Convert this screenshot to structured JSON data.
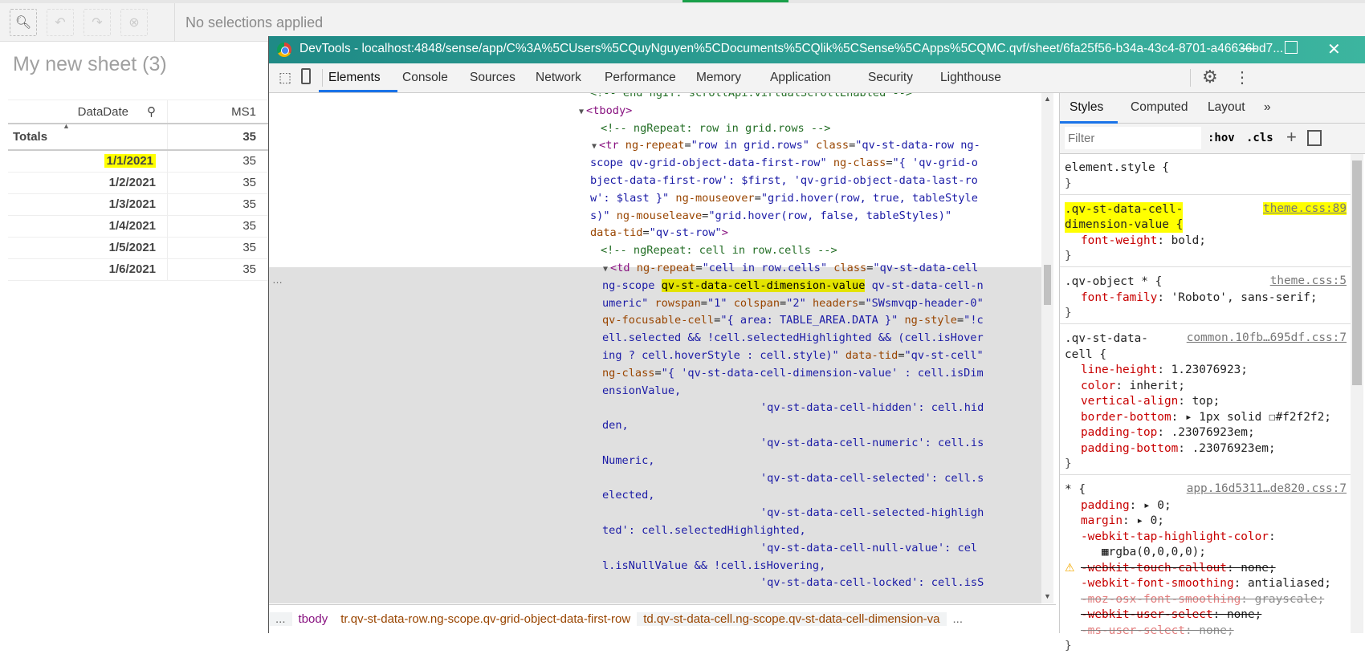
{
  "qlik": {
    "selections_text": "No selections applied",
    "sheet_title": "My new sheet (3)",
    "table": {
      "headers": [
        "DataDate",
        "MS1"
      ],
      "totals_label": "Totals",
      "totals_value": "35",
      "rows": [
        {
          "date": "1/1/2021",
          "value": "35",
          "highlighted": true
        },
        {
          "date": "1/2/2021",
          "value": "35"
        },
        {
          "date": "1/3/2021",
          "value": "35"
        },
        {
          "date": "1/4/2021",
          "value": "35"
        },
        {
          "date": "1/5/2021",
          "value": "35"
        },
        {
          "date": "1/6/2021",
          "value": "35"
        }
      ]
    }
  },
  "devtools": {
    "title": "DevTools - localhost:4848/sense/app/C%3A%5CUsers%5CQuyNguyen%5CDocuments%5CQlik%5CSense%5CApps%5CQMC.qvf/sheet/6fa25f56-b34a-43c4-8701-a46636bd7...",
    "tabs": [
      "Elements",
      "Console",
      "Sources",
      "Network",
      "Performance",
      "Memory",
      "Application",
      "Security",
      "Lighthouse"
    ],
    "active_tab": "Elements",
    "code_lines": [
      [
        [
          "cm",
          "<!-- end ngIf: scrollApi.virtualScrollEnabled -->"
        ]
      ],
      [
        [
          "tri",
          "▼"
        ],
        [
          "tg",
          "<tbody>"
        ]
      ],
      [
        [
          "cm",
          "<!-- ngRepeat: row in grid.rows -->"
        ]
      ],
      [
        [
          "tri",
          "▼"
        ],
        [
          "tg",
          "<tr"
        ],
        [
          "at",
          " ng-repeat"
        ],
        [
          "tx",
          "="
        ],
        [
          "vl",
          "\"row in grid.rows\""
        ],
        [
          "at",
          " class"
        ],
        [
          "tx",
          "="
        ],
        [
          "vl",
          "\"qv-st-data-row ng-"
        ]
      ],
      [
        [
          "vl",
          "scope qv-grid-object-data-first-row\""
        ],
        [
          "at",
          " ng-class"
        ],
        [
          "tx",
          "="
        ],
        [
          "vl",
          "\"{ 'qv-grid-o"
        ]
      ],
      [
        [
          "vl",
          "bject-data-first-row': $first, 'qv-grid-object-data-last-ro"
        ]
      ],
      [
        [
          "vl",
          "w': $last }\""
        ],
        [
          "at",
          " ng-mouseover"
        ],
        [
          "tx",
          "="
        ],
        [
          "vl",
          "\"grid.hover(row, true, tableStyle"
        ]
      ],
      [
        [
          "vl",
          "s)\""
        ],
        [
          "at",
          " ng-mouseleave"
        ],
        [
          "tx",
          "="
        ],
        [
          "vl",
          "\"grid.hover(row, false, tableStyles)\""
        ]
      ],
      [
        [
          "at",
          "data-tid"
        ],
        [
          "tx",
          "="
        ],
        [
          "vl",
          "\"qv-st-row\""
        ],
        [
          "tg",
          ">"
        ]
      ],
      [
        [
          "cm",
          "<!-- ngRepeat: cell in row.cells -->"
        ]
      ],
      [
        [
          "tri",
          "▼"
        ],
        [
          "tg",
          "<td"
        ],
        [
          "at",
          " ng-repeat"
        ],
        [
          "tx",
          "="
        ],
        [
          "vl",
          "\"cell in row.cells\""
        ],
        [
          "at",
          " class"
        ],
        [
          "tx",
          "="
        ],
        [
          "vl",
          "\"qv-st-data-cell"
        ]
      ],
      [
        [
          "vl",
          "ng-scope "
        ],
        [
          "yhl",
          "qv-st-data-cell-dimension-value"
        ],
        [
          "vl",
          " qv-st-data-cell-n"
        ]
      ],
      [
        [
          "vl",
          "umeric\""
        ],
        [
          "at",
          " rowspan"
        ],
        [
          "tx",
          "="
        ],
        [
          "vl",
          "\"1\""
        ],
        [
          "at",
          " colspan"
        ],
        [
          "tx",
          "="
        ],
        [
          "vl",
          "\"2\""
        ],
        [
          "at",
          " headers"
        ],
        [
          "tx",
          "="
        ],
        [
          "vl",
          "\"SWsmvqp-header-0\""
        ]
      ],
      [
        [
          "at",
          "qv-focusable-cell"
        ],
        [
          "tx",
          "="
        ],
        [
          "vl",
          "\"{ area: TABLE_AREA.DATA }\""
        ],
        [
          "at",
          " ng-style"
        ],
        [
          "tx",
          "="
        ],
        [
          "vl",
          "\"!c"
        ]
      ],
      [
        [
          "vl",
          "ell.selected && !cell.selectedHighlighted && (cell.isHover"
        ]
      ],
      [
        [
          "vl",
          "ing ? cell.hoverStyle : cell.style)\""
        ],
        [
          "at",
          " data-tid"
        ],
        [
          "tx",
          "="
        ],
        [
          "vl",
          "\"qv-st-cell\""
        ]
      ],
      [
        [
          "at",
          "ng-class"
        ],
        [
          "tx",
          "="
        ],
        [
          "vl",
          "\"{ 'qv-st-data-cell-dimension-value' : cell.isDim"
        ]
      ],
      [
        [
          "vl",
          "ensionValue,"
        ]
      ],
      [
        [
          "vl",
          "'qv-st-data-cell-hidden': cell.hid"
        ]
      ],
      [
        [
          "vl",
          "den,"
        ]
      ],
      [
        [
          "vl",
          "'qv-st-data-cell-numeric': cell.is"
        ]
      ],
      [
        [
          "vl",
          "Numeric,"
        ]
      ],
      [
        [
          "vl",
          "'qv-st-data-cell-selected': cell.s"
        ]
      ],
      [
        [
          "vl",
          "elected,"
        ]
      ],
      [
        [
          "vl",
          "'qv-st-data-cell-selected-highligh"
        ]
      ],
      [
        [
          "vl",
          "ted': cell.selectedHighlighted,"
        ]
      ],
      [
        [
          "vl",
          "'qv-st-data-cell-null-value': cel"
        ]
      ],
      [
        [
          "vl",
          "l.isNullValue && !cell.isHovering,"
        ]
      ],
      [
        [
          "vl",
          "'qv-st-data-cell-locked': cell.isS"
        ]
      ]
    ],
    "breadcrumbs": [
      "...",
      "tbody",
      "tr.qv-st-data-row.ng-scope.qv-grid-object-data-first-row",
      "td.qv-st-data-cell.ng-scope.qv-st-data-cell-dimension-va",
      "..."
    ],
    "styles": {
      "tabs": [
        "Styles",
        "Computed",
        "Layout",
        "»"
      ],
      "filter_placeholder": "Filter",
      "hov": ":hov",
      "cls": ".cls",
      "rules": [
        {
          "selector": [
            "element.style {"
          ],
          "source": "",
          "props": []
        },
        {
          "selector": [
            ".qv-st-data-cell-",
            "dimension-value {"
          ],
          "source": "theme.css:89",
          "highlighted": true,
          "props": [
            {
              "name": "font-weight",
              "value": "bold;"
            }
          ]
        },
        {
          "selector": [
            ".qv-object * {"
          ],
          "source": "theme.css:5",
          "props": [
            {
              "name": "font-family",
              "value": "'Roboto', sans-serif;"
            }
          ]
        },
        {
          "selector": [
            ".qv-st-data-",
            "cell {"
          ],
          "source": "common.10fb…695df.css:7",
          "props": [
            {
              "name": "line-height",
              "value": "1.23076923;"
            },
            {
              "name": "color",
              "value": "inherit;"
            },
            {
              "name": "vertical-align",
              "value": "top;"
            },
            {
              "name": "border-bottom",
              "value": "▸ 1px solid ☐#f2f2f2;"
            },
            {
              "name": "padding-top",
              "value": ".23076923em;"
            },
            {
              "name": "padding-bottom",
              "value": ".23076923em;"
            }
          ]
        },
        {
          "selector": [
            "* {"
          ],
          "source": "app.16d5311…de820.css:7",
          "props": [
            {
              "name": "padding",
              "value": "▸ 0;"
            },
            {
              "name": "margin",
              "value": "▸ 0;"
            },
            {
              "name": "-webkit-tap-highlight-color",
              "value": ""
            },
            {
              "name": "",
              "value": "   ▦rgba(0,0,0,0);"
            },
            {
              "name": "-webkit-touch-callout",
              "value": "none;",
              "struck": true,
              "warning": true
            },
            {
              "name": "-webkit-font-smoothing",
              "value": "antialiased;"
            },
            {
              "name": "-moz-osx-font-smoothing",
              "value": "grayscale;",
              "struck": true,
              "faded": true
            },
            {
              "name": "-webkit-user-select",
              "value": "none;",
              "struck": true
            },
            {
              "name": "-ms-user-select",
              "value": "none;",
              "struck": true,
              "faded": true
            }
          ]
        }
      ]
    }
  },
  "colors": {
    "highlight": "#ffff00",
    "devtools_titlebar": "#2a9d8f",
    "active_tab_underline": "#1a73e8"
  }
}
